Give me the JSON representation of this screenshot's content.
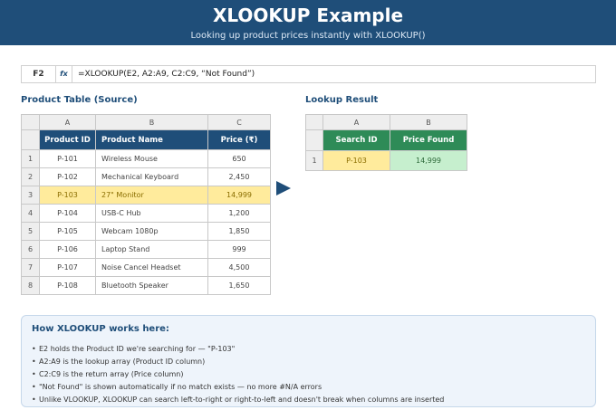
{
  "header": {
    "title": "XLOOKUP Example",
    "subtitle": "Looking up product prices instantly with XLOOKUP()"
  },
  "formula_bar": {
    "cell_ref": "F2",
    "fx_label": "fx",
    "formula": "=XLOOKUP(E2, A2:A9, C2:C9, “Not Found”)"
  },
  "source": {
    "section_title": "Product Table (Source)",
    "column_letters": [
      "A",
      "B",
      "C"
    ],
    "headers": [
      "Product ID",
      "Product Name",
      "Price (₹)"
    ],
    "rows": [
      {
        "num": "1",
        "id": "P-101",
        "name": "Wireless Mouse",
        "price": "650"
      },
      {
        "num": "2",
        "id": "P-102",
        "name": "Mechanical Keyboard",
        "price": "2,450"
      },
      {
        "num": "3",
        "id": "P-103",
        "name": "27\" Monitor",
        "price": "14,999"
      },
      {
        "num": "4",
        "id": "P-104",
        "name": "USB-C Hub",
        "price": "1,200"
      },
      {
        "num": "5",
        "id": "P-105",
        "name": "Webcam 1080p",
        "price": "1,850"
      },
      {
        "num": "6",
        "id": "P-106",
        "name": "Laptop Stand",
        "price": "999"
      },
      {
        "num": "7",
        "id": "P-107",
        "name": "Noise Cancel Headset",
        "price": "4,500"
      },
      {
        "num": "8",
        "id": "P-108",
        "name": "Bluetooth Speaker",
        "price": "1,650"
      }
    ],
    "highlight_color": "#ffeb9c",
    "header_color": "#1f4e79"
  },
  "result": {
    "section_title": "Lookup Result",
    "column_letters": [
      "A",
      "B"
    ],
    "headers": [
      "Search ID",
      "Price Found"
    ],
    "row_num": "1",
    "search_id": "P-103",
    "price_found": "14,999",
    "header_color": "#2e8b57",
    "result_color": "#c6efce"
  },
  "info": {
    "title": "How XLOOKUP works here:",
    "bullets": [
      "E2 holds the Product ID we're searching for — \"P-103\"",
      "A2:A9 is the lookup array (Product ID column)",
      "C2:C9 is the return array (Price column)",
      "\"Not Found\" is shown automatically if no match exists — no more #N/A errors",
      "Unlike VLOOKUP, XLOOKUP can search left-to-right or right-to-left and doesn't break when columns are inserted"
    ]
  }
}
